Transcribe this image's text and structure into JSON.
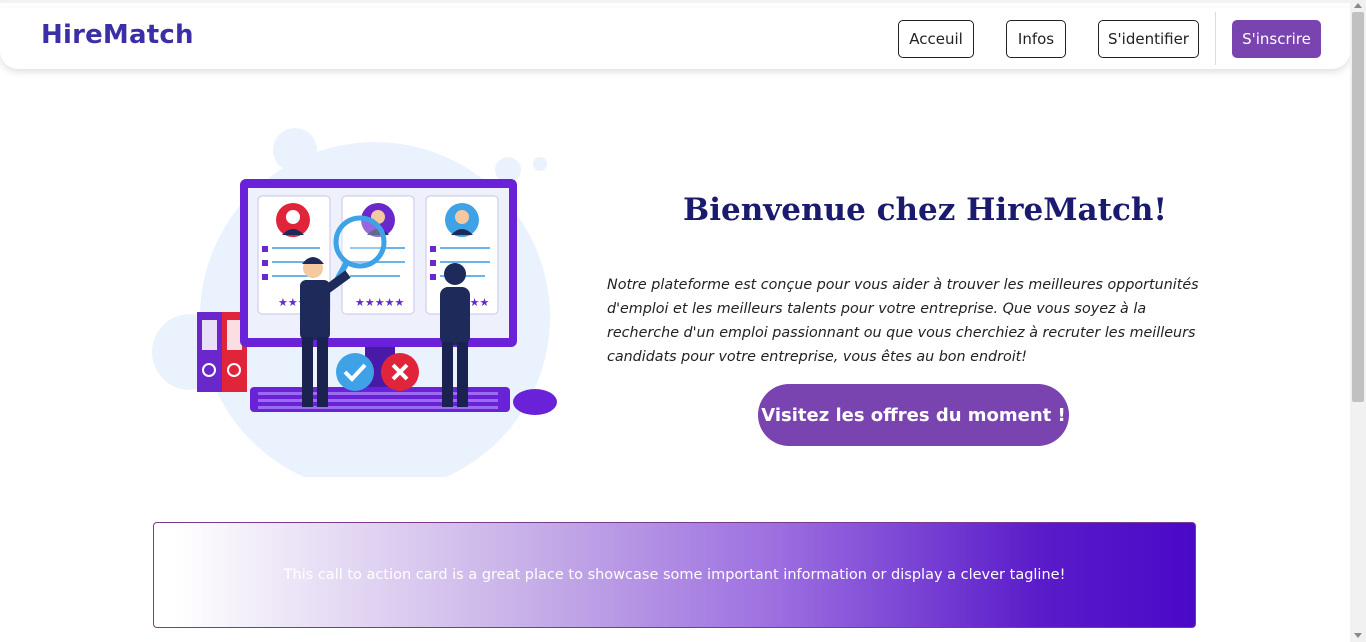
{
  "brand": {
    "name": "HireMatch"
  },
  "nav": {
    "items": [
      {
        "label": "Acceuil"
      },
      {
        "label": "Infos"
      },
      {
        "label": "S'identifier"
      }
    ],
    "signup_label": "S'inscrire"
  },
  "hero": {
    "title": "Bienvenue chez HireMatch!",
    "text": "Notre plateforme est conçue pour vous aider à trouver les meilleures opportunités d'emploi et les meilleurs talents pour votre entreprise. Que vous soyez à la recherche d'un emploi passionnant ou que vous cherchiez à recruter les meilleurs candidats pour votre entreprise, vous êtes au bon endroit!",
    "cta_label": "Visitez les offres du moment !"
  },
  "card": {
    "text": "This call to action card is a great place to showcase some important information or display a clever tagline!"
  },
  "colors": {
    "brand": "#3b2fa8",
    "primary": "#7a44b0",
    "title": "#1a1a6e",
    "card_gradient_end": "#4a08c8"
  }
}
